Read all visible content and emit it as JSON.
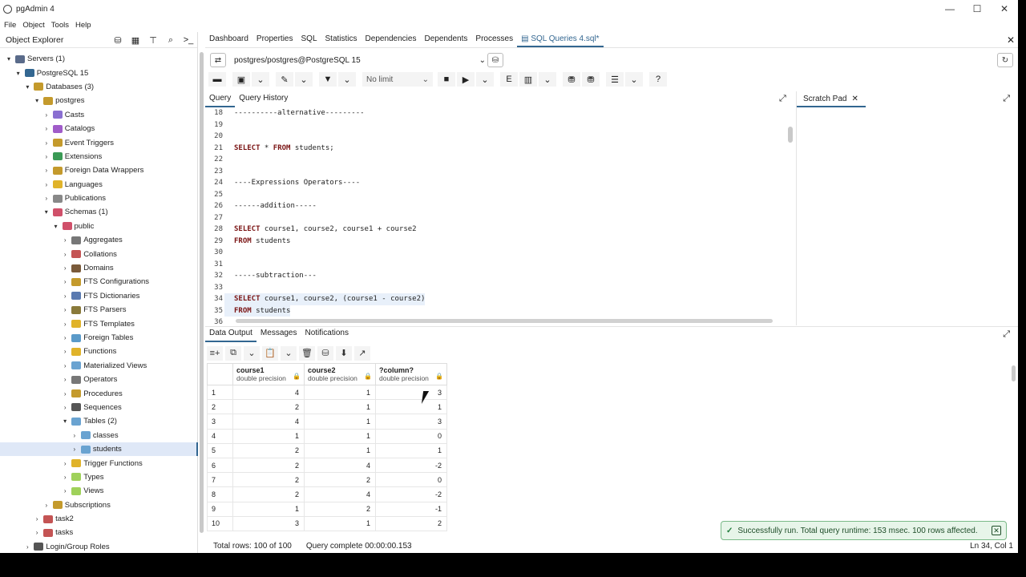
{
  "window": {
    "title": "pgAdmin 4",
    "controls": [
      "—",
      "☐",
      "✕"
    ]
  },
  "menu": [
    "File",
    "Object",
    "Tools",
    "Help"
  ],
  "explorer": {
    "title": "Object Explorer",
    "tree": [
      {
        "label": "Servers (1)",
        "depth": 0,
        "chev": "▾",
        "color": "#5a6b8a"
      },
      {
        "label": "PostgreSQL 15",
        "depth": 1,
        "chev": "▾",
        "color": "#336791"
      },
      {
        "label": "Databases (3)",
        "depth": 2,
        "chev": "▾",
        "color": "#c49a2c"
      },
      {
        "label": "postgres",
        "depth": 3,
        "chev": "▾",
        "color": "#c49a2c"
      },
      {
        "label": "Casts",
        "depth": 4,
        "chev": "›",
        "color": "#8a6fd1"
      },
      {
        "label": "Catalogs",
        "depth": 4,
        "chev": "›",
        "color": "#a05cc9"
      },
      {
        "label": "Event Triggers",
        "depth": 4,
        "chev": "›",
        "color": "#c49a2c"
      },
      {
        "label": "Extensions",
        "depth": 4,
        "chev": "›",
        "color": "#3a9a55"
      },
      {
        "label": "Foreign Data Wrappers",
        "depth": 4,
        "chev": "›",
        "color": "#c49a2c"
      },
      {
        "label": "Languages",
        "depth": 4,
        "chev": "›",
        "color": "#e0b32a"
      },
      {
        "label": "Publications",
        "depth": 4,
        "chev": "›",
        "color": "#888888"
      },
      {
        "label": "Schemas (1)",
        "depth": 4,
        "chev": "▾",
        "color": "#d0506a"
      },
      {
        "label": "public",
        "depth": 5,
        "chev": "▾",
        "color": "#d0506a"
      },
      {
        "label": "Aggregates",
        "depth": 6,
        "chev": "›",
        "color": "#777777"
      },
      {
        "label": "Collations",
        "depth": 6,
        "chev": "›",
        "color": "#c45454"
      },
      {
        "label": "Domains",
        "depth": 6,
        "chev": "›",
        "color": "#7a5a3a"
      },
      {
        "label": "FTS Configurations",
        "depth": 6,
        "chev": "›",
        "color": "#c49a2c"
      },
      {
        "label": "FTS Dictionaries",
        "depth": 6,
        "chev": "›",
        "color": "#5a7ab0"
      },
      {
        "label": "FTS Parsers",
        "depth": 6,
        "chev": "›",
        "color": "#8a7a3a"
      },
      {
        "label": "FTS Templates",
        "depth": 6,
        "chev": "›",
        "color": "#e0b32a"
      },
      {
        "label": "Foreign Tables",
        "depth": 6,
        "chev": "›",
        "color": "#5a9ac9"
      },
      {
        "label": "Functions",
        "depth": 6,
        "chev": "›",
        "color": "#e0b32a"
      },
      {
        "label": "Materialized Views",
        "depth": 6,
        "chev": "›",
        "color": "#6aa3d1"
      },
      {
        "label": "Operators",
        "depth": 6,
        "chev": "›",
        "color": "#777777"
      },
      {
        "label": "Procedures",
        "depth": 6,
        "chev": "›",
        "color": "#c49a2c"
      },
      {
        "label": "Sequences",
        "depth": 6,
        "chev": "›",
        "color": "#555555"
      },
      {
        "label": "Tables (2)",
        "depth": 6,
        "chev": "▾",
        "color": "#6aa3d1"
      },
      {
        "label": "classes",
        "depth": 7,
        "chev": "›",
        "color": "#6aa3d1"
      },
      {
        "label": "students",
        "depth": 7,
        "chev": "›",
        "color": "#6aa3d1",
        "selected": true
      },
      {
        "label": "Trigger Functions",
        "depth": 6,
        "chev": "›",
        "color": "#e0b32a"
      },
      {
        "label": "Types",
        "depth": 6,
        "chev": "›",
        "color": "#9fd15a"
      },
      {
        "label": "Views",
        "depth": 6,
        "chev": "›",
        "color": "#9fd15a"
      },
      {
        "label": "Subscriptions",
        "depth": 4,
        "chev": "›",
        "color": "#c49a2c"
      },
      {
        "label": "task2",
        "depth": 3,
        "chev": "›",
        "color": "#c45454"
      },
      {
        "label": "tasks",
        "depth": 3,
        "chev": "›",
        "color": "#c45454"
      },
      {
        "label": "Login/Group Roles",
        "depth": 2,
        "chev": "›",
        "color": "#555555"
      }
    ]
  },
  "tabs": [
    "Dashboard",
    "Properties",
    "SQL",
    "Statistics",
    "Dependencies",
    "Dependents",
    "Processes",
    "SQL Queries 4.sql*"
  ],
  "connection": "postgres/postgres@PostgreSQL 15",
  "limit": "No limit",
  "query_tabs": [
    "Query",
    "Query History"
  ],
  "scratch_title": "Scratch Pad",
  "editor_lines": [
    {
      "no": "18",
      "code": "----------alternative---------",
      "type": "cm"
    },
    {
      "no": "19",
      "code": "",
      "type": "plain"
    },
    {
      "no": "20",
      "code": "",
      "type": "plain"
    },
    {
      "no": "21",
      "code": "SELECT * FROM students;",
      "type": "sql"
    },
    {
      "no": "22",
      "code": "",
      "type": "plain"
    },
    {
      "no": "23",
      "code": "",
      "type": "plain"
    },
    {
      "no": "24",
      "code": "----Expressions Operators----",
      "type": "cm"
    },
    {
      "no": "25",
      "code": "",
      "type": "plain"
    },
    {
      "no": "26",
      "code": "------addition-----",
      "type": "cm"
    },
    {
      "no": "27",
      "code": "",
      "type": "plain"
    },
    {
      "no": "28",
      "code": "SELECT course1, course2, course1 + course2",
      "type": "sql"
    },
    {
      "no": "29",
      "code": "FROM students",
      "type": "sql"
    },
    {
      "no": "30",
      "code": "",
      "type": "plain"
    },
    {
      "no": "31",
      "code": "",
      "type": "plain"
    },
    {
      "no": "32",
      "code": "-----subtraction---",
      "type": "cm"
    },
    {
      "no": "33",
      "code": "",
      "type": "plain"
    },
    {
      "no": "34",
      "code": "SELECT course1, course2, (course1 - course2)",
      "type": "sql",
      "hl": true
    },
    {
      "no": "35",
      "code": "FROM students",
      "type": "sql",
      "hl": true
    },
    {
      "no": "36",
      "code": "",
      "type": "plain"
    }
  ],
  "result_tabs": [
    "Data Output",
    "Messages",
    "Notifications"
  ],
  "columns": [
    {
      "name": "course1",
      "type": "double precision"
    },
    {
      "name": "course2",
      "type": "double precision"
    },
    {
      "name": "?column?",
      "type": "double precision"
    }
  ],
  "rows": [
    [
      "1",
      "4",
      "1",
      "3"
    ],
    [
      "2",
      "2",
      "1",
      "1"
    ],
    [
      "3",
      "4",
      "1",
      "3"
    ],
    [
      "4",
      "1",
      "1",
      "0"
    ],
    [
      "5",
      "2",
      "1",
      "1"
    ],
    [
      "6",
      "2",
      "4",
      "-2"
    ],
    [
      "7",
      "2",
      "2",
      "0"
    ],
    [
      "8",
      "2",
      "4",
      "-2"
    ],
    [
      "9",
      "1",
      "2",
      "-1"
    ],
    [
      "10",
      "3",
      "1",
      "2"
    ]
  ],
  "status": {
    "rows": "Total rows: 100 of 100",
    "query": "Query complete 00:00:00.153",
    "position": "Ln 34, Col 1"
  },
  "toast": "Successfully run. Total query runtime: 153 msec. 100 rows affected."
}
